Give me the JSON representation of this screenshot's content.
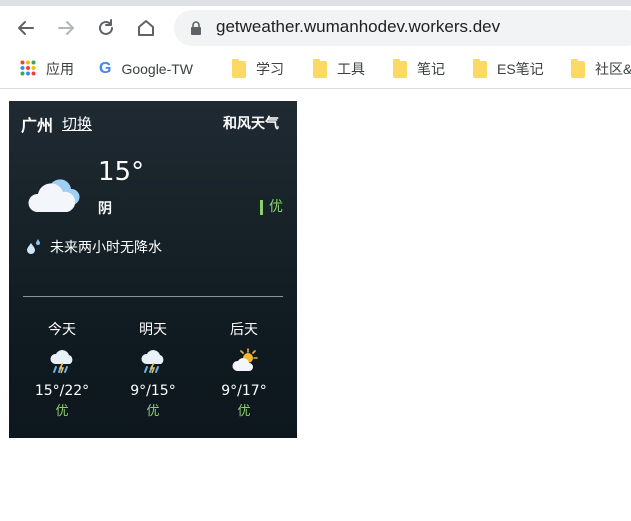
{
  "browser": {
    "url": "getweather.wumanhodev.workers.dev",
    "bookmarks": [
      {
        "label": "应用",
        "icon": "apps-grid-icon"
      },
      {
        "label": "Google-TW",
        "icon": "google-icon"
      },
      {
        "label": "学习",
        "icon": "folder-icon"
      },
      {
        "label": "工具",
        "icon": "folder-icon"
      },
      {
        "label": "笔记",
        "icon": "folder-icon"
      },
      {
        "label": "ES笔记",
        "icon": "folder-icon"
      },
      {
        "label": "社区&",
        "icon": "folder-icon"
      }
    ]
  },
  "weather": {
    "city": "广州",
    "switch_label": "切换",
    "brand": "和风天气",
    "current": {
      "temp": "15°",
      "condition": "阴",
      "aqi": "优",
      "icon": "cloudy-icon"
    },
    "precip_note": "未来两小时无降水",
    "forecast": [
      {
        "day": "今天",
        "range": "15°/22°",
        "aqi": "优",
        "icon": "thunder-rain-icon"
      },
      {
        "day": "明天",
        "range": "9°/15°",
        "aqi": "优",
        "icon": "thunder-rain-icon"
      },
      {
        "day": "后天",
        "range": "9°/17°",
        "aqi": "优",
        "icon": "sunny-cloudy-icon"
      }
    ]
  },
  "colors": {
    "aqi_good": "#8bd16b",
    "widget_bg": "#14202a"
  }
}
